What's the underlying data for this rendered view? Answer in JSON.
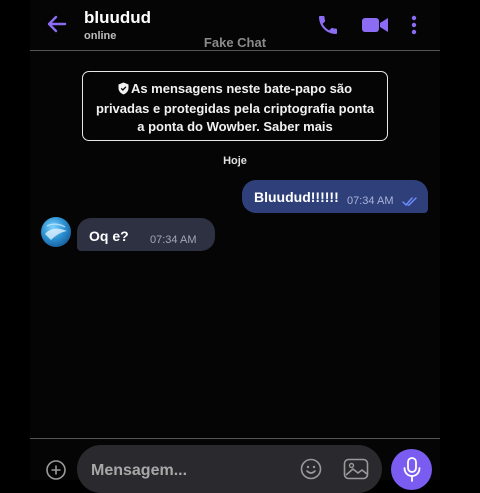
{
  "header": {
    "contact_name": "bluudud",
    "status": "online",
    "title": "Fake Chat"
  },
  "notice": {
    "text": "As mensagens neste bate-papo são privadas e protegidas pela criptografia ponta a ponta do Wowber. Saber mais"
  },
  "date_separator": "Hoje",
  "messages": [
    {
      "direction": "outgoing",
      "text": "Bluudud!!!!!!",
      "time": "07:34 AM",
      "read": true
    },
    {
      "direction": "incoming",
      "text": "Oq e?",
      "time": "07:34 AM"
    }
  ],
  "composer": {
    "placeholder": "Mensagem..."
  },
  "icons": {
    "back": "arrow-left-icon",
    "call": "phone-icon",
    "video": "video-camera-icon",
    "more": "more-vertical-icon",
    "add": "plus-circle-icon",
    "emoji": "emoji-icon",
    "gallery": "image-icon",
    "mic": "microphone-icon"
  },
  "colors": {
    "accent": "#7a5cf0",
    "outgoing_bubble": "#2f3f79",
    "incoming_bubble": "#2d3142",
    "read_ticks": "#6f8dff"
  }
}
